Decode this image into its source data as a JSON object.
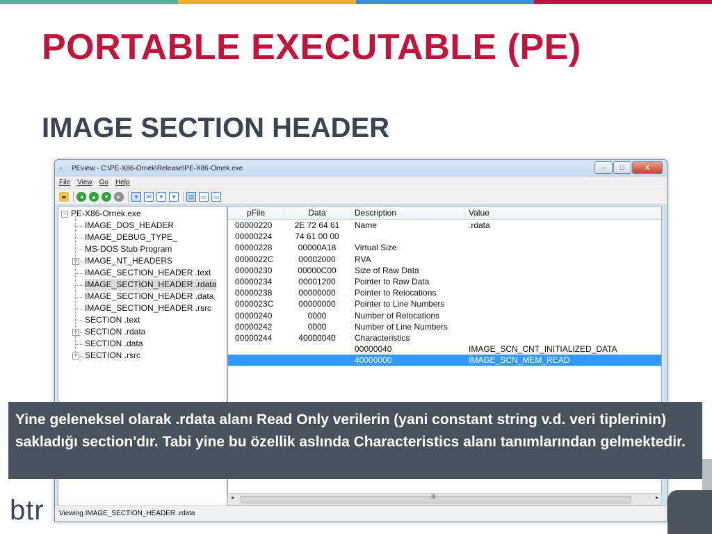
{
  "topbar_colors": [
    "#4bb8a0",
    "#f2b233",
    "#3b8fd8",
    "#c0143c"
  ],
  "slide": {
    "title": "PORTABLE EXECUTABLE (PE)",
    "subtitle": "IMAGE SECTION HEADER",
    "caption": "Yine geleneksel olarak .rdata alanı Read Only verilerin (yani constant string v.d. veri tiplerinin) sakladığı section'dır. Tabi yine bu özellik aslında Characteristics alanı tanımlarından gelmektedir.",
    "logo_text": "btr"
  },
  "window": {
    "title": "PEview - C:\\PE-X86-Ornek\\Release\\PE-X86-Ornek.exe",
    "buttons": {
      "minimize": "–",
      "maximize": "□",
      "close": "X"
    },
    "menu": [
      "File",
      "View",
      "Go",
      "Help"
    ],
    "status": "Viewing IMAGE_SECTION_HEADER .rdata",
    "scroll_grip": "III"
  },
  "tree": [
    {
      "label": "PE-X86-Ornek.exe",
      "expander": "−",
      "level": 0
    },
    {
      "label": "IMAGE_DOS_HEADER",
      "level": 1
    },
    {
      "label": "IMAGE_DEBUG_TYPE_",
      "level": 1
    },
    {
      "label": "MS-DOS Stub Program",
      "level": 1
    },
    {
      "label": "IMAGE_NT_HEADERS",
      "expander": "+",
      "level": 1
    },
    {
      "label": "IMAGE_SECTION_HEADER .text",
      "level": 1
    },
    {
      "label": "IMAGE_SECTION_HEADER .rdata",
      "level": 1,
      "selected": true
    },
    {
      "label": "IMAGE_SECTION_HEADER .data",
      "level": 1
    },
    {
      "label": "IMAGE_SECTION_HEADER .rsrc",
      "level": 1
    },
    {
      "label": "SECTION .text",
      "level": 1
    },
    {
      "label": "SECTION .rdata",
      "expander": "+",
      "level": 1
    },
    {
      "label": "SECTION .data",
      "level": 1
    },
    {
      "label": "SECTION .rsrc",
      "expander": "+",
      "level": 1
    }
  ],
  "table": {
    "headers": [
      "pFile",
      "Data",
      "Description",
      "Value"
    ],
    "rows": [
      [
        "00000220",
        "2E  72  64  61",
        "Name",
        ".rdata"
      ],
      [
        "00000224",
        "74  61  00  00",
        "",
        ""
      ],
      [
        "00000228",
        "00000A18",
        "Virtual Size",
        ""
      ],
      [
        "0000022C",
        "00002000",
        "RVA",
        ""
      ],
      [
        "00000230",
        "00000C00",
        "Size of Raw Data",
        ""
      ],
      [
        "00000234",
        "00001200",
        "Pointer to Raw Data",
        ""
      ],
      [
        "00000238",
        "00000000",
        "Pointer to Relocations",
        ""
      ],
      [
        "0000023C",
        "00000000",
        "Pointer to Line Numbers",
        ""
      ],
      [
        "00000240",
        "0000",
        "Number of Relocations",
        ""
      ],
      [
        "00000242",
        "0000",
        "Number of Line Numbers",
        ""
      ],
      [
        "00000244",
        "40000040",
        "Characteristics",
        ""
      ],
      [
        "",
        "",
        "00000040",
        "IMAGE_SCN_CNT_INITIALIZED_DATA"
      ],
      [
        "",
        "",
        "40000000",
        "IMAGE_SCN_MEM_READ"
      ]
    ],
    "selected_row": 12
  }
}
